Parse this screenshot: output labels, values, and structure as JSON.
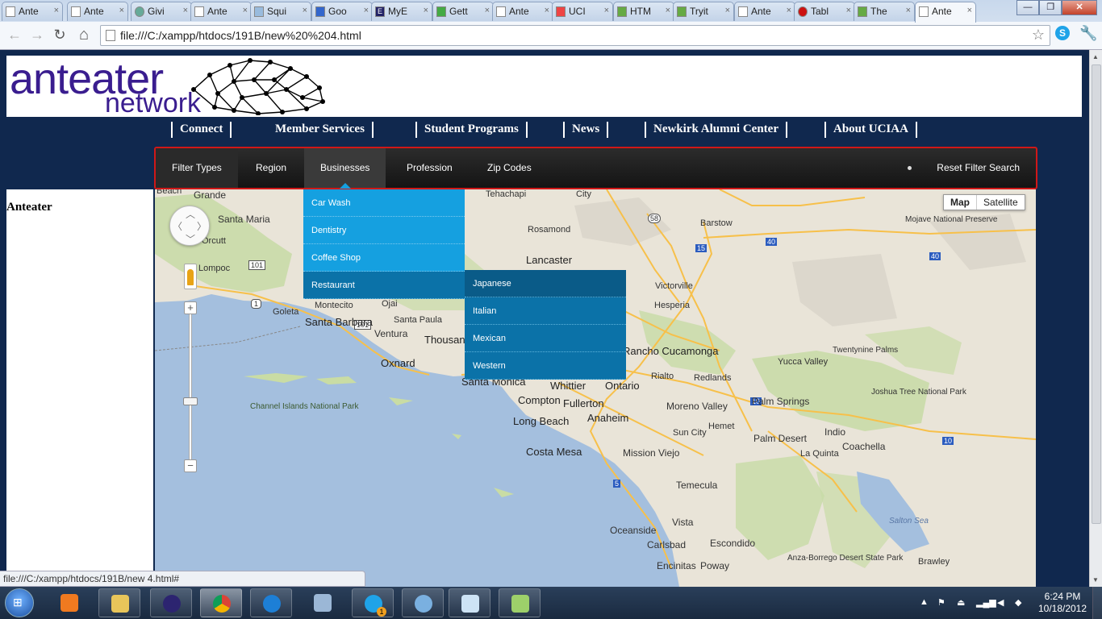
{
  "browser": {
    "tabs": [
      {
        "label": "Ante",
        "icon": "page-icon"
      },
      {
        "label": "Ante",
        "icon": "page-icon"
      },
      {
        "label": "Givi",
        "icon": "globe-icon"
      },
      {
        "label": "Ante",
        "icon": "page-icon"
      },
      {
        "label": "Squi",
        "icon": "squirrel-icon"
      },
      {
        "label": "Goo",
        "icon": "phone-icon"
      },
      {
        "label": "MyE",
        "icon": "e-icon"
      },
      {
        "label": "Gett",
        "icon": "google-icon"
      },
      {
        "label": "Ante",
        "icon": "page-icon"
      },
      {
        "label": "UCI",
        "icon": "uci-icon"
      },
      {
        "label": "HTM",
        "icon": "w3-icon"
      },
      {
        "label": "Tryit",
        "icon": "w3-icon"
      },
      {
        "label": "Ante",
        "icon": "page-icon"
      },
      {
        "label": "Tabl",
        "icon": "ball-icon"
      },
      {
        "label": "The",
        "icon": "w3-icon"
      },
      {
        "label": "Ante",
        "icon": "page-icon"
      }
    ],
    "tab_close": "×",
    "window_buttons": {
      "minimize": "—",
      "maximize": "❐",
      "close": "✕"
    },
    "nav": {
      "back": "←",
      "forward": "→",
      "reload": "↻",
      "home": "⌂"
    },
    "url": "file:///C:/xampp/htdocs/191B/new%20%204.html",
    "star": "☆",
    "wrench": "🔧",
    "status_url": "file:///C:/xampp/htdocs/191B/new  4.html#"
  },
  "site": {
    "logo_line1": "anteater",
    "logo_line2": "network",
    "main_nav": [
      "Connect",
      "Member Services",
      "Student Programs",
      "News",
      "Newkirk Alumni Center",
      "About UCIAA"
    ],
    "filter_bar": [
      "Filter Types",
      "Region",
      "Businesses",
      "Profession",
      "Zip Codes"
    ],
    "filter_active": "Businesses",
    "reset_label": "Reset Filter Search",
    "sidebar_title": "Anteater",
    "business_menu": [
      "Car Wash",
      "Dentistry",
      "Coffee Shop",
      "Restaurant"
    ],
    "restaurant_menu": [
      "Japanese",
      "Italian",
      "Mexican",
      "Western"
    ]
  },
  "map": {
    "type_buttons": [
      "Map",
      "Satellite"
    ],
    "zoom_in": "+",
    "zoom_out": "−",
    "labels": [
      "Beach",
      "Grande",
      "Santa Maria",
      "Orcutt",
      "Lompoc",
      "Goleta",
      "Montecito",
      "Ojai",
      "Santa Barbara",
      "Santa Paula",
      "Ventura",
      "Thousand Oaks",
      "Oxnard",
      "Channel Islands National Park",
      "Tehachapi",
      "City",
      "Rosamond",
      "Lancaster",
      "Barstow",
      "Mojave National Preserve",
      "Victorville",
      "Hesperia",
      "Rancho Cucamonga",
      "Rialto",
      "Redlands",
      "Yucca Valley",
      "Twentynine Palms",
      "Joshua Tree National Park",
      "Santa Monica",
      "Whittier",
      "Ontario",
      "Compton",
      "Fullerton",
      "Long Beach",
      "Anaheim",
      "Moreno Valley",
      "Hemet",
      "Sun City",
      "Palm Springs",
      "Palm Desert",
      "Indio",
      "Coachella",
      "La Quinta",
      "Costa Mesa",
      "Mission Viejo",
      "Temecula",
      "Oceanside",
      "Carlsbad",
      "Vista",
      "Escondido",
      "Encinitas",
      "Poway",
      "Anza-Borrego Desert State Park",
      "Salton Sea",
      "Brawley"
    ],
    "highways": [
      "101",
      "1",
      "101",
      "58",
      "15",
      "40",
      "40",
      "10",
      "10",
      "5"
    ]
  },
  "taskbar": {
    "apps": [
      "media-player-icon",
      "explorer-icon",
      "eclipse-icon",
      "chrome-icon",
      "ie-icon",
      "winamp-icon",
      "skype-icon",
      "notifier-icon",
      "notepad-icon",
      "notepadpp-icon"
    ],
    "skype_badge": "1",
    "clock_time": "6:24 PM",
    "clock_date": "10/18/2012",
    "tray_arrow": "▲"
  },
  "colors": {
    "page_bg": "#10284e",
    "logo": "#3a1d8f",
    "dropdown": "#15a0e0",
    "dropdown_hover": "#0b72a8",
    "filter_border": "#d01818",
    "filter_bg": "#1e1e1e"
  }
}
